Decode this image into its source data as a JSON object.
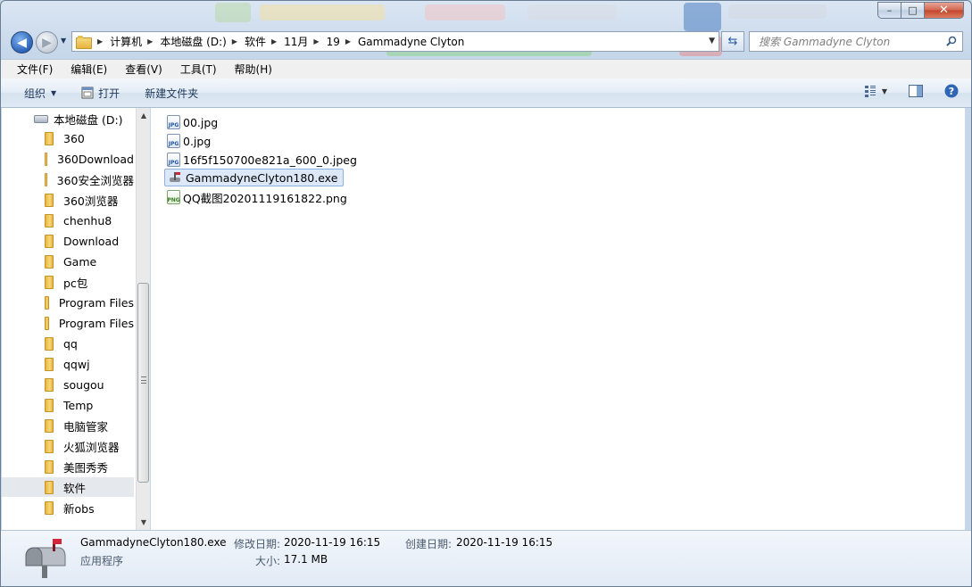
{
  "window": {
    "controls": {
      "minimize": "–",
      "maximize": "□",
      "close": "✕"
    }
  },
  "address_bar": {
    "crumbs": [
      "计算机",
      "本地磁盘 (D:)",
      "软件",
      "11月",
      "19",
      "Gammadyne Clyton"
    ]
  },
  "search": {
    "placeholder": "搜索 Gammadyne Clyton"
  },
  "menu": [
    "文件(F)",
    "编辑(E)",
    "查看(V)",
    "工具(T)",
    "帮助(H)"
  ],
  "toolbar": {
    "organize": "组织",
    "open": "打开",
    "new_folder": "新建文件夹"
  },
  "tree": {
    "drive": "本地磁盘 (D:)",
    "folders": [
      "360",
      "360Download",
      "360安全浏览器",
      "360浏览器",
      "chenhu8",
      "Download",
      "Game",
      "pc包",
      "Program Files",
      "Program Files",
      "qq",
      "qqwj",
      "sougou",
      "Temp",
      "电脑管家",
      "火狐浏览器",
      "美图秀秀",
      "软件",
      "新obs"
    ],
    "selected": "软件"
  },
  "files": [
    {
      "name": "00.jpg",
      "type": "jpg",
      "badge": "JPG"
    },
    {
      "name": "0.jpg",
      "type": "jpg",
      "badge": "JPG"
    },
    {
      "name": "16f5f150700e821a_600_0.jpeg",
      "type": "jpg",
      "badge": "JPG"
    },
    {
      "name": "GammadyneClyton180.exe",
      "type": "exe",
      "selected": true
    },
    {
      "name": "QQ截图20201119161822.png",
      "type": "png",
      "badge": "PNG"
    }
  ],
  "details": {
    "filename": "GammadyneClyton180.exe",
    "filetype": "应用程序",
    "modified_label": "修改日期:",
    "modified_value": "2020-11-19 16:15",
    "created_label": "创建日期:",
    "created_value": "2020-11-19 16:15",
    "size_label": "大小:",
    "size_value": "17.1 MB"
  },
  "colors": {
    "accent": "#2a63b8",
    "selection": "#dce8f7",
    "toolbar_text": "#1e395b"
  },
  "icons": [
    "back-icon",
    "forward-icon",
    "folder-icon",
    "refresh-icon",
    "search-icon",
    "view-options-icon",
    "preview-pane-icon",
    "help-icon",
    "open-icon",
    "drive-icon",
    "mailbox-icon"
  ]
}
